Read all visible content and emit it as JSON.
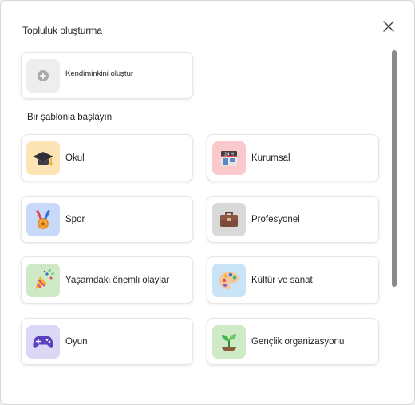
{
  "dialog": {
    "title": "Topluluk oluşturma",
    "close_icon": "close-icon"
  },
  "create_own": {
    "label": "Kendiminkini oluştur",
    "icon": "plus-circle-icon"
  },
  "section_heading": "Bir şablonla başlayın",
  "templates": [
    {
      "label": "Okul",
      "icon": "graduation-cap-icon",
      "tile_color": "#fde4b4"
    },
    {
      "label": "Kurumsal",
      "icon": "office-building-icon",
      "tile_color": "#f9c9cb"
    },
    {
      "label": "Spor",
      "icon": "medal-icon",
      "tile_color": "#c9daf8"
    },
    {
      "label": "Profesyonel",
      "icon": "briefcase-icon",
      "tile_color": "#d9d9d9"
    },
    {
      "label": "Yaşamdaki önemli olaylar",
      "icon": "party-popper-icon",
      "tile_color": "#cfe9c6"
    },
    {
      "label": "Kültür ve sanat",
      "icon": "palette-icon",
      "tile_color": "#c9e4f6"
    },
    {
      "label": "Oyun",
      "icon": "gamepad-icon",
      "tile_color": "#dad8f5"
    },
    {
      "label": "Gençlik organizasyonu",
      "icon": "sprout-icon",
      "tile_color": "#cfeac6"
    }
  ]
}
